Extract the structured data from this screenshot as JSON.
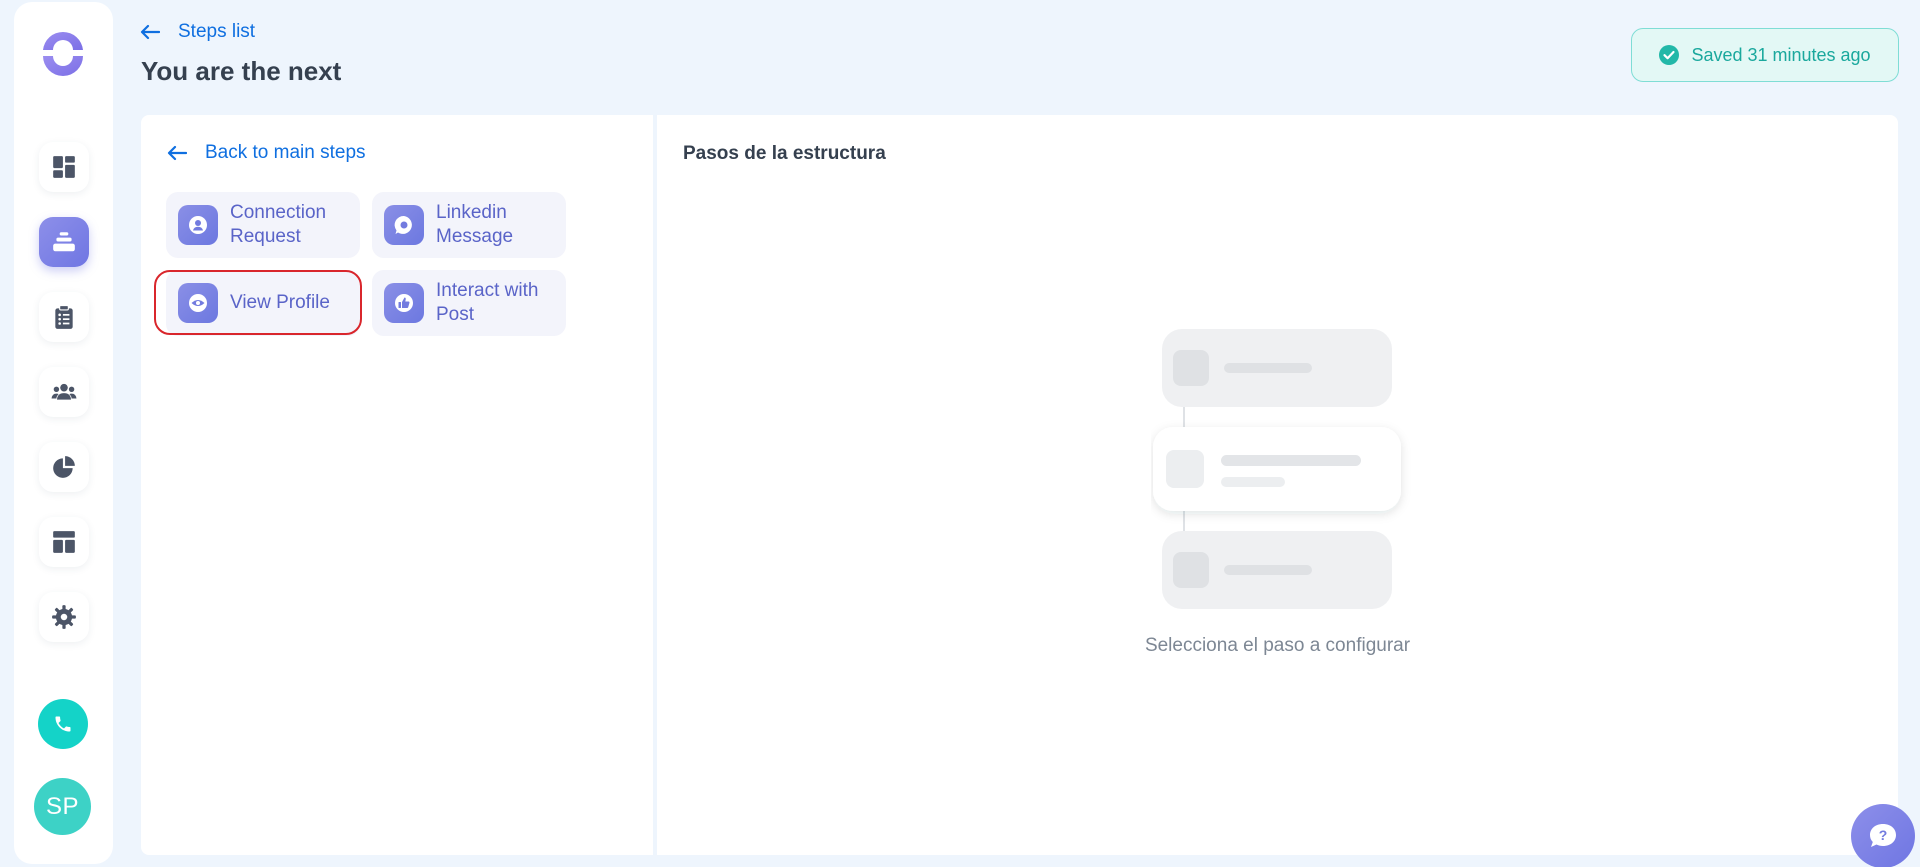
{
  "header": {
    "back_label": "Steps list",
    "title": "You are the next",
    "saved_status": "Saved 31 minutes ago"
  },
  "sidebar": {
    "items": [
      {
        "name": "dashboard",
        "icon": "dashboard-icon",
        "active": false
      },
      {
        "name": "campaigns",
        "icon": "layers-icon",
        "active": true
      },
      {
        "name": "tasks",
        "icon": "clipboard-icon",
        "active": false
      },
      {
        "name": "contacts",
        "icon": "users-icon",
        "active": false
      },
      {
        "name": "reports",
        "icon": "pie-chart-icon",
        "active": false
      },
      {
        "name": "templates",
        "icon": "layout-icon",
        "active": false
      },
      {
        "name": "settings",
        "icon": "gear-icon",
        "active": false
      }
    ],
    "avatar_initials": "SP"
  },
  "steps_panel": {
    "back_label": "Back to main steps",
    "steps": [
      {
        "label": "Connection Request",
        "icon": "user-icon"
      },
      {
        "label": "Linkedin Message",
        "icon": "chat-icon"
      },
      {
        "label": "View Profile",
        "icon": "eye-icon"
      },
      {
        "label": "Interact with Post",
        "icon": "thumbs-up-icon"
      }
    ]
  },
  "structure_panel": {
    "title": "Pasos de la estructura",
    "empty_message": "Selecciona el paso a configurar"
  },
  "colors": {
    "accent": "#0f6fe0",
    "primary_gradient_start": "#8d8fe9",
    "primary_gradient_end": "#6f76e3",
    "success": "#1aa89d",
    "highlight": "#d9262c"
  }
}
